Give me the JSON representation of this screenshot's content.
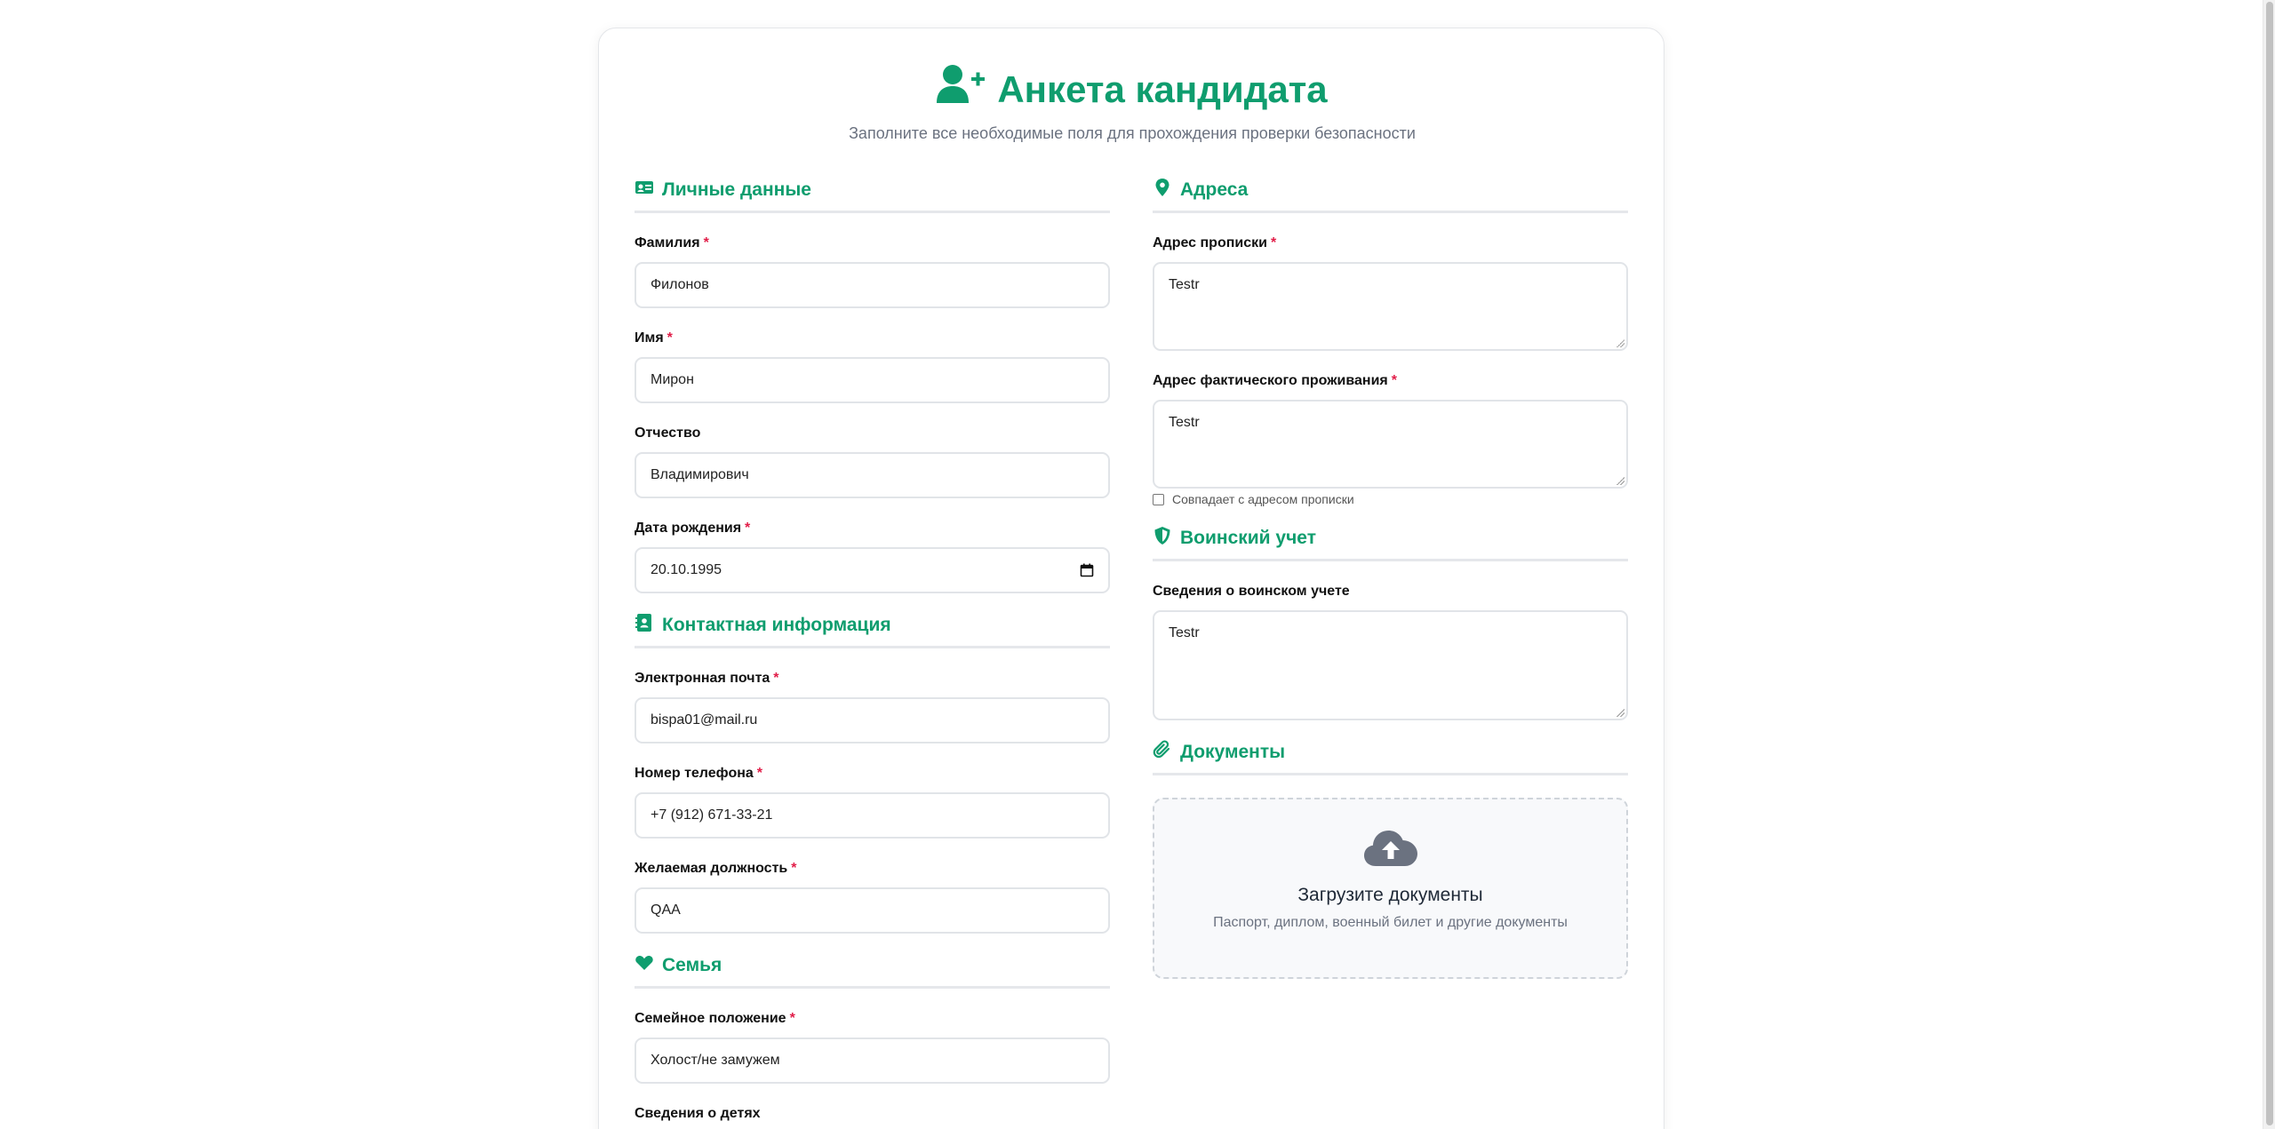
{
  "header": {
    "title": "Анкета кандидата",
    "subtitle": "Заполните все необходимые поля для прохождения проверки безопасности"
  },
  "personal": {
    "section_title": "Личные данные",
    "last_name": {
      "label": "Фамилия",
      "required": "*",
      "value": "Филонов"
    },
    "first_name": {
      "label": "Имя",
      "required": "*",
      "value": "Мирон"
    },
    "patronymic": {
      "label": "Отчество",
      "value": "Владимирович"
    },
    "birth_date": {
      "label": "Дата рождения",
      "required": "*",
      "value": "20.10.1995"
    }
  },
  "contacts": {
    "section_title": "Контактная информация",
    "email": {
      "label": "Электронная почта",
      "required": "*",
      "value": "bispa01@mail.ru"
    },
    "phone": {
      "label": "Номер телефона",
      "required": "*",
      "value": "+7 (912) 671-33-21"
    },
    "position": {
      "label": "Желаемая должность",
      "required": "*",
      "value": "QAA"
    }
  },
  "family": {
    "section_title": "Семья",
    "marital_status": {
      "label": "Семейное положение",
      "required": "*",
      "value": "Холост/не замужем"
    },
    "children": {
      "label": "Сведения о детях"
    }
  },
  "addresses": {
    "section_title": "Адреса",
    "registration": {
      "label": "Адрес прописки",
      "required": "*",
      "value": "Testr"
    },
    "actual": {
      "label": "Адрес фактического проживания",
      "required": "*",
      "value": "Testr"
    },
    "same_as_registration": {
      "label": "Совпадает с адресом прописки",
      "checked": false
    }
  },
  "military": {
    "section_title": "Воинский учет",
    "info": {
      "label": "Сведения о воинском учете",
      "value": "Testr"
    }
  },
  "documents": {
    "section_title": "Документы",
    "upload_title": "Загрузите документы",
    "upload_hint": "Паспорт, диплом, военный билет и другие документы"
  },
  "colors": {
    "accent": "#0f9d6e",
    "required": "#e11d48",
    "muted": "#6b7280"
  },
  "icons": [
    "user-plus-icon",
    "id-card-icon",
    "address-book-icon",
    "heart-icon",
    "map-pin-icon",
    "shield-icon",
    "paperclip-icon",
    "cloud-upload-icon",
    "calendar-icon"
  ]
}
